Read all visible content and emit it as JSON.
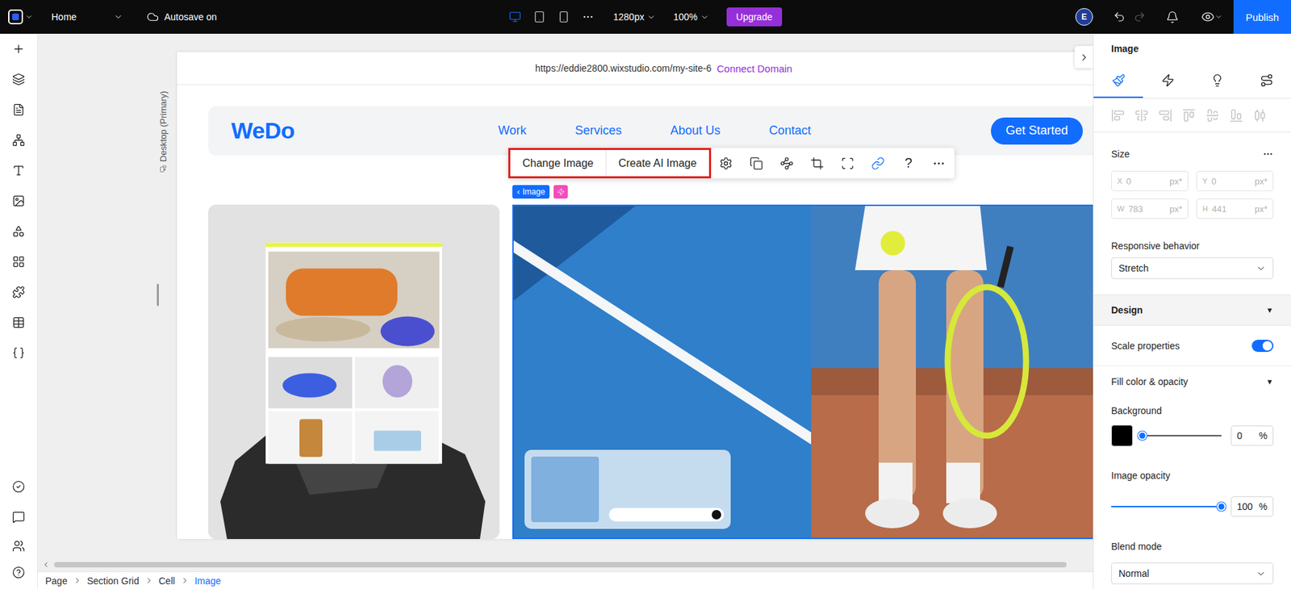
{
  "topbar": {
    "page": "Home",
    "autosave": "Autosave on",
    "devices": [
      {
        "kind": "desktop",
        "selected": true
      },
      {
        "kind": "tablet",
        "selected": false
      },
      {
        "kind": "mobile",
        "selected": false
      }
    ],
    "width": "1280px",
    "zoom": "100%",
    "upgrade": "Upgrade",
    "avatar": "E",
    "undo": {
      "disabled": false
    },
    "redo": {
      "disabled": true
    },
    "publish": "Publish"
  },
  "canvas": {
    "url": "https://eddie2800.wixstudio.com/my-site-6",
    "connect": "Connect Domain",
    "breakpoint": "Desktop (Primary)"
  },
  "site": {
    "logo": "WeDo",
    "nav": [
      "Work",
      "Services",
      "About Us",
      "Contact"
    ],
    "cta": "Get Started"
  },
  "toolbar": {
    "highlighted": true,
    "buttons": [
      "Change Image",
      "Create AI Image"
    ],
    "icons": [
      {
        "kind": "settings",
        "active": false
      },
      {
        "kind": "animation",
        "active": false
      },
      {
        "kind": "connect",
        "active": false
      },
      {
        "kind": "crop",
        "active": false
      },
      {
        "kind": "focus",
        "active": false
      },
      {
        "kind": "link",
        "active": true
      }
    ],
    "help": "?"
  },
  "selection": {
    "chevron": "‹",
    "label": "Image"
  },
  "panel": {
    "title": "Image",
    "tabs": [
      {
        "kind": "design",
        "selected": true
      },
      {
        "kind": "interactions",
        "selected": false
      },
      {
        "kind": "tips",
        "selected": false
      },
      {
        "kind": "connect",
        "selected": false
      }
    ],
    "align": [
      {
        "kind": "left",
        "disabled": true
      },
      {
        "kind": "center",
        "disabled": true
      },
      {
        "kind": "right",
        "disabled": true
      },
      {
        "kind": "top",
        "disabled": true
      },
      {
        "kind": "middle",
        "disabled": true
      },
      {
        "kind": "bottom",
        "disabled": true
      },
      {
        "kind": "distribute",
        "disabled": true
      }
    ],
    "size": {
      "title": "Size",
      "fields": [
        {
          "axis": "X",
          "value": "0",
          "unit": "px*",
          "disabled": true
        },
        {
          "axis": "Y",
          "value": "0",
          "unit": "px*",
          "disabled": true
        },
        {
          "axis": "W",
          "value": "783",
          "unit": "px*",
          "disabled": true
        },
        {
          "axis": "H",
          "value": "441",
          "unit": "px*",
          "disabled": true
        }
      ]
    },
    "responsive": {
      "label": "Responsive behavior",
      "value": "Stretch"
    },
    "design": {
      "title": "Design",
      "toggle": "▼"
    },
    "scale": {
      "label": "Scale properties",
      "on": true
    },
    "fill": {
      "title": "Fill color & opacity",
      "toggle": "▼"
    },
    "background": {
      "label": "Background",
      "color": "#000000",
      "level": 0,
      "value": "0",
      "unit": "%"
    },
    "opacity": {
      "label": "Image opacity",
      "level": 1,
      "value": "100",
      "unit": "%"
    },
    "blend": {
      "label": "Blend mode",
      "value": "Normal"
    }
  },
  "breadcrumb": [
    {
      "label": "Page",
      "selected": false
    },
    {
      "label": "Section Grid",
      "selected": false
    },
    {
      "label": "Cell",
      "selected": false
    },
    {
      "label": "Image",
      "selected": true
    }
  ]
}
